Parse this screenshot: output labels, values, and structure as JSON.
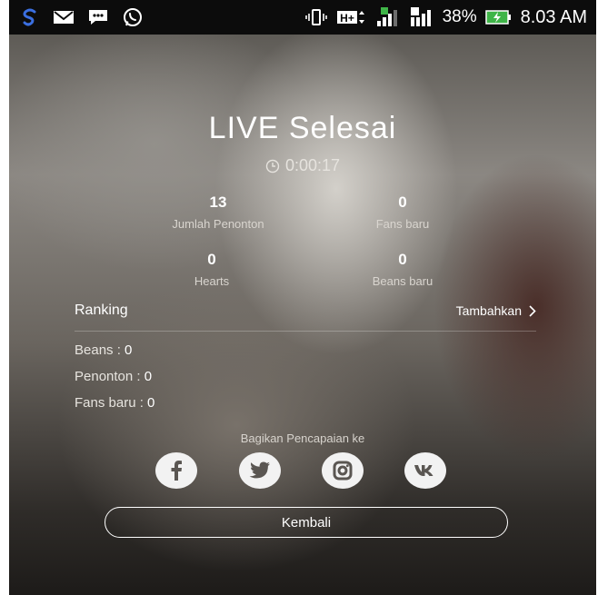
{
  "status_bar": {
    "battery": "38%",
    "time": "8.03 AM",
    "icons": [
      "s-app-icon",
      "email-icon",
      "bbm-icon",
      "whatsapp-icon",
      "vibrate-icon",
      "hplus-network-icon",
      "signal-sim1-icon",
      "signal-sim2-icon",
      "battery-charging-icon"
    ]
  },
  "summary": {
    "title": "LIVE Selesai",
    "duration": "0:00:17"
  },
  "stats": {
    "viewers": {
      "value": "13",
      "label": "Jumlah Penonton"
    },
    "new_fans": {
      "value": "0",
      "label": "Fans baru"
    },
    "hearts": {
      "value": "0",
      "label": "Hearts"
    },
    "new_beans": {
      "value": "0",
      "label": "Beans baru"
    }
  },
  "ranking": {
    "label": "Ranking",
    "add_label": "Tambahkan",
    "items": [
      {
        "label": "Beans : ",
        "value": "0"
      },
      {
        "label": "Penonton : ",
        "value": "0"
      },
      {
        "label": "Fans baru : ",
        "value": "0"
      }
    ]
  },
  "share": {
    "label": "Bagikan Pencapaian ke",
    "networks": [
      "facebook-icon",
      "twitter-icon",
      "instagram-icon",
      "vk-icon"
    ]
  },
  "back_button": {
    "label": "Kembali"
  },
  "colors": {
    "status_bar_bg": "#0c0c0c",
    "text": "#ffffff",
    "social_circle": "#f2f2f2",
    "social_glyph": "#5a5652"
  }
}
